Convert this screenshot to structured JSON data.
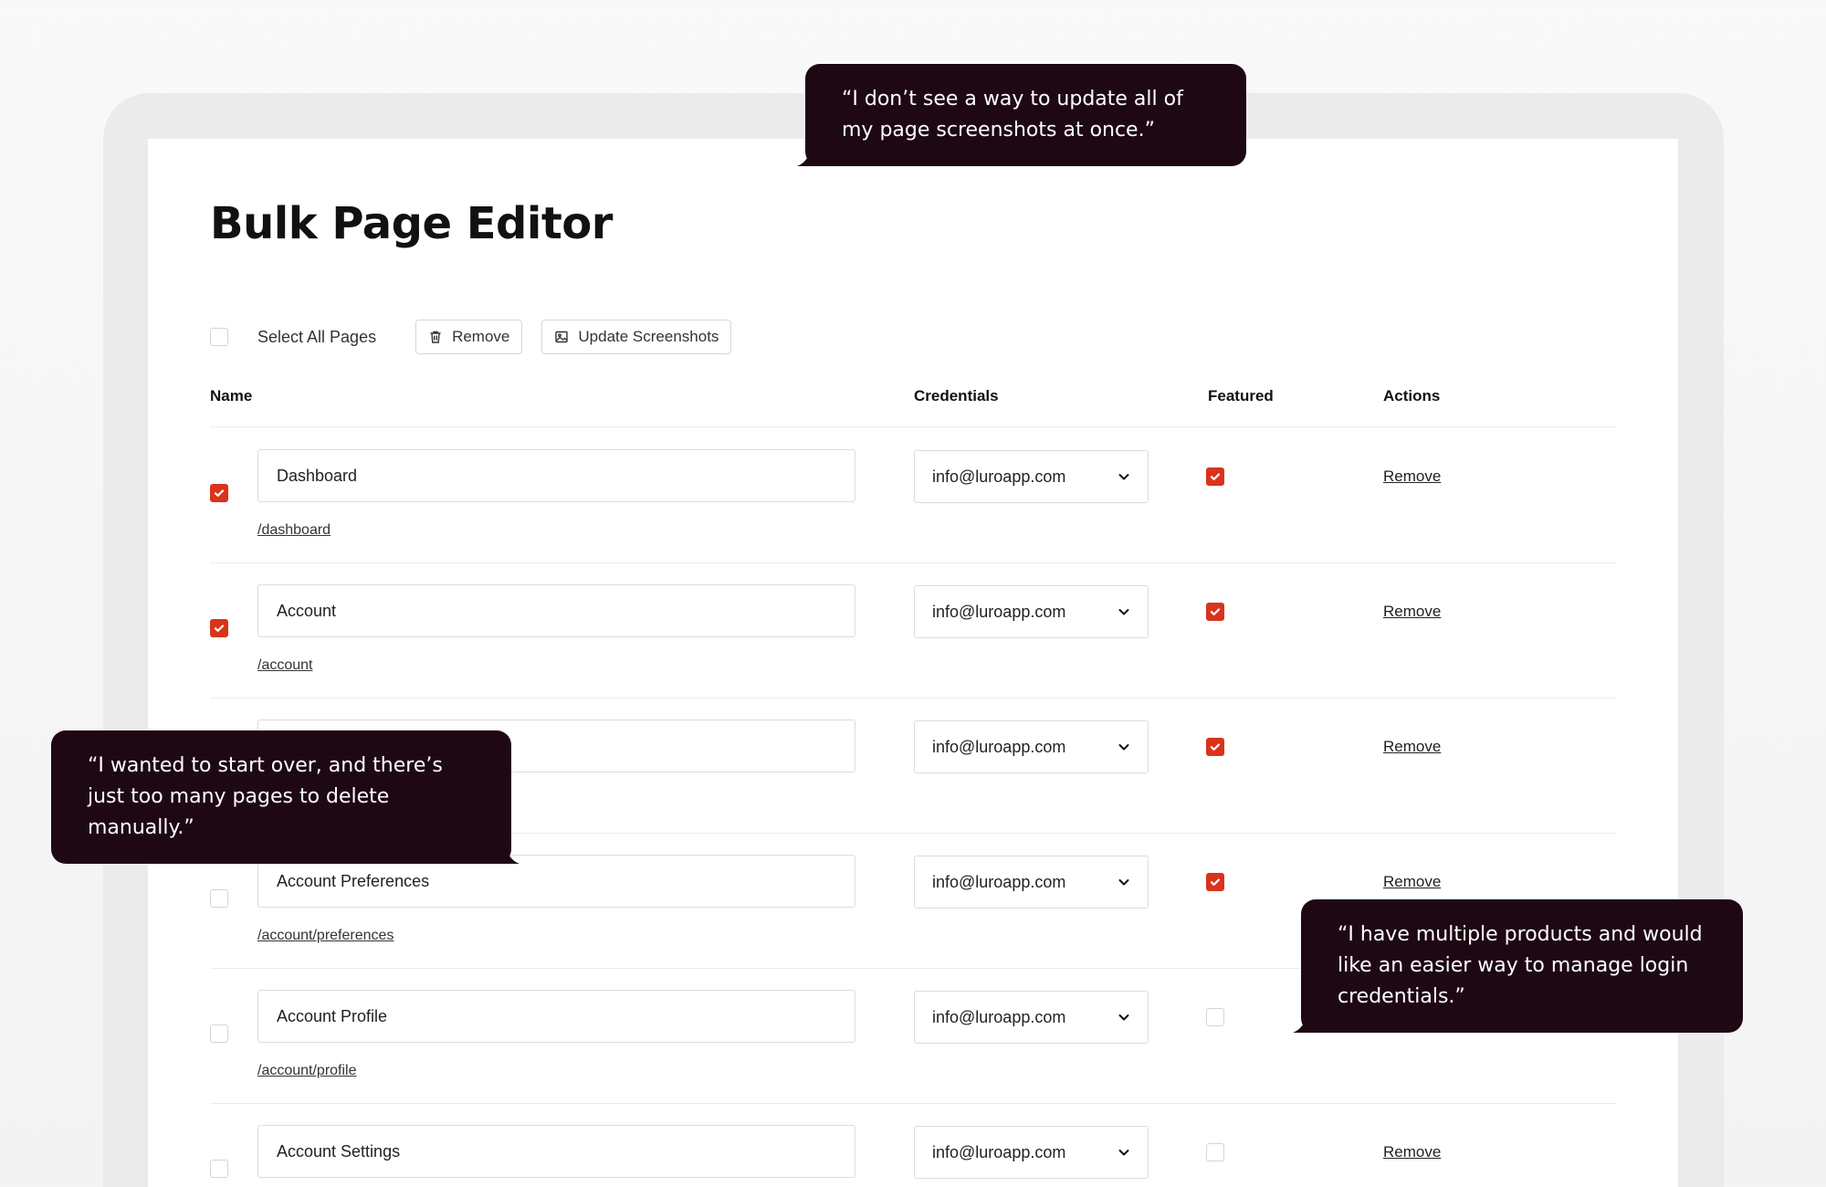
{
  "page": {
    "title": "Bulk Page Editor"
  },
  "toolbar": {
    "select_all_label": "Select All Pages",
    "remove_label": "Remove",
    "update_label": "Update Screenshots"
  },
  "table": {
    "headers": {
      "name": "Name",
      "credentials": "Credentials",
      "featured": "Featured",
      "actions": "Actions"
    },
    "rows": [
      {
        "selected": true,
        "name": "Dashboard",
        "slug": "/dashboard",
        "credential": "info@luroapp.com",
        "featured": true,
        "action": "Remove"
      },
      {
        "selected": true,
        "name": "Account",
        "slug": "/account",
        "credential": "info@luroapp.com",
        "featured": true,
        "action": "Remove"
      },
      {
        "selected": false,
        "name": "",
        "slug": "",
        "credential": "info@luroapp.com",
        "featured": true,
        "action": "Remove"
      },
      {
        "selected": false,
        "name": "Account Preferences",
        "slug": "/account/preferences",
        "credential": "info@luroapp.com",
        "featured": true,
        "action": "Remove"
      },
      {
        "selected": false,
        "name": "Account Profile",
        "slug": "/account/profile",
        "credential": "info@luroapp.com",
        "featured": false,
        "action": ""
      },
      {
        "selected": false,
        "name": "Account Settings",
        "slug": "",
        "credential": "info@luroapp.com",
        "featured": false,
        "action": "Remove"
      }
    ]
  },
  "quotes": [
    "“I don’t see a way to update all of my page screenshots at once.”",
    "“I wanted to start over, and there’s just too many pages to delete manually.”",
    "“I have multiple products and would like an easier way to manage login credentials.”"
  ],
  "colors": {
    "accent": "#d9341b",
    "bubble": "#1e0814"
  }
}
